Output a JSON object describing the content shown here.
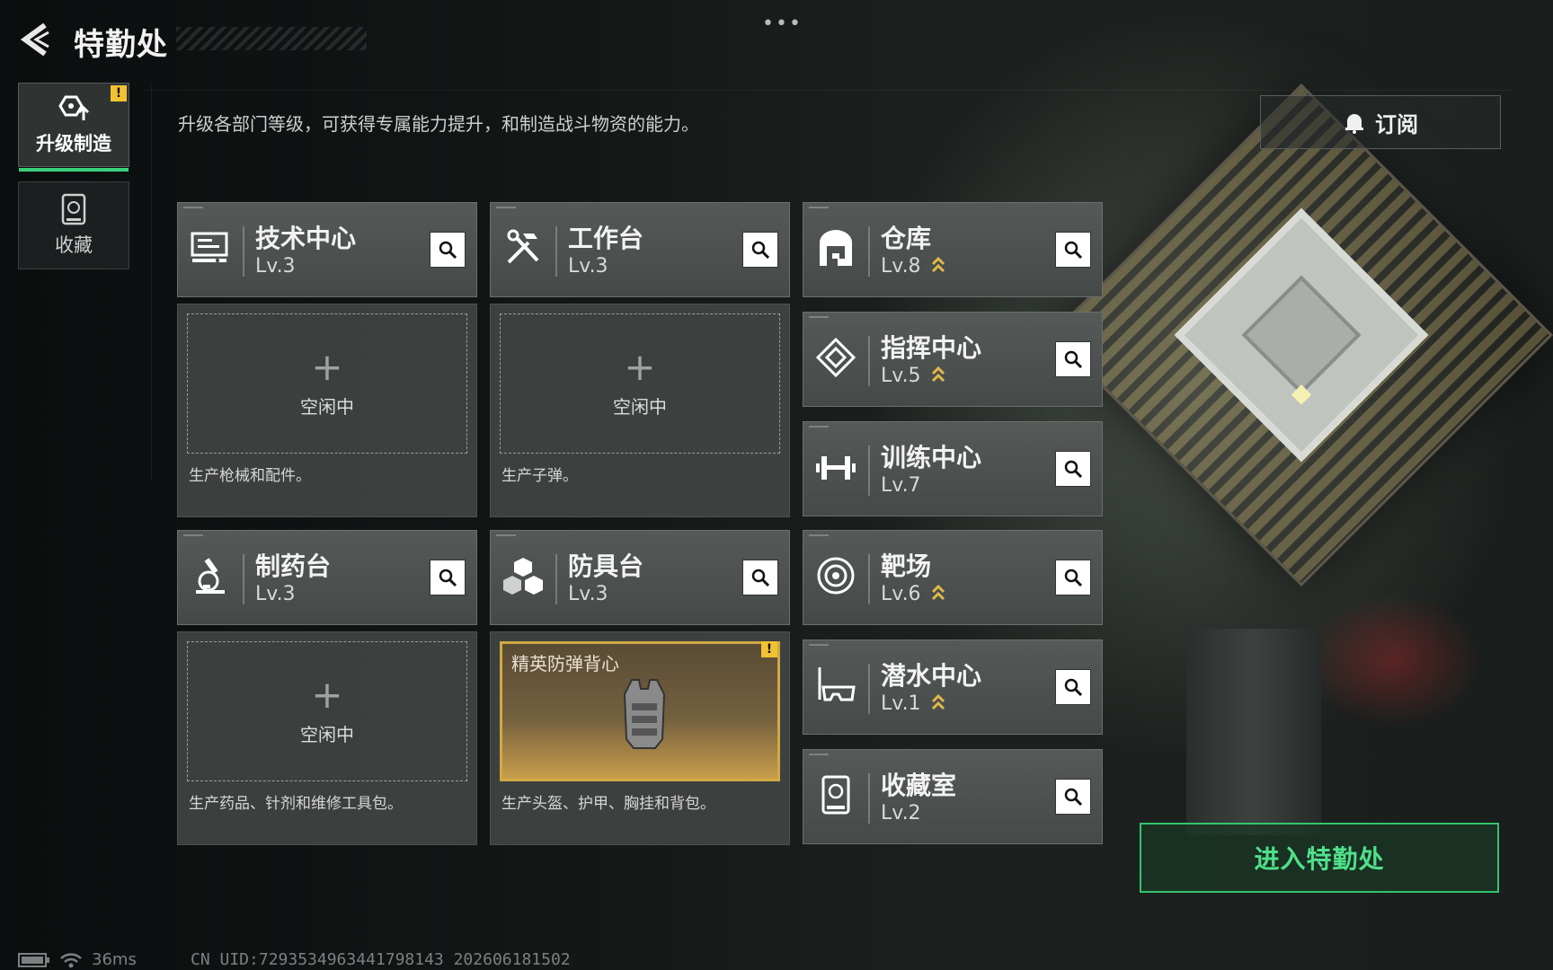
{
  "header": {
    "title": "特勤处"
  },
  "sidebar": {
    "tabs": [
      {
        "label": "升级制造",
        "active": true,
        "alert": "!"
      },
      {
        "label": "收藏",
        "active": false
      }
    ]
  },
  "main": {
    "description": "升级各部门等级，可获得专属能力提升，和制造战斗物资的能力。",
    "subscribe_label": "订阅",
    "enter_label": "进入特勤处"
  },
  "workshops": [
    {
      "name": "技术中心",
      "level": "Lv.3",
      "icon": "monitor-icon",
      "slot_plus": "+",
      "slot_text": "空闲中",
      "desc": "生产枪械和配件。"
    },
    {
      "name": "工作台",
      "level": "Lv.3",
      "icon": "tools-icon",
      "slot_plus": "+",
      "slot_text": "空闲中",
      "desc": "生产子弹。"
    },
    {
      "name": "制药台",
      "level": "Lv.3",
      "icon": "microscope-icon",
      "slot_plus": "+",
      "slot_text": "空闲中",
      "desc": "生产药品、针剂和维修工具包。"
    },
    {
      "name": "防具台",
      "level": "Lv.3",
      "icon": "cubes-icon",
      "crafting_item": "精英防弹背心",
      "alert": "!",
      "desc": "生产头盔、护甲、胸挂和背包。"
    }
  ],
  "facilities": [
    {
      "name": "仓库",
      "level": "Lv.8",
      "upgradable": true,
      "icon": "warehouse-icon"
    },
    {
      "name": "指挥中心",
      "level": "Lv.5",
      "upgradable": true,
      "icon": "command-icon"
    },
    {
      "name": "训练中心",
      "level": "Lv.7",
      "upgradable": false,
      "icon": "dumbbell-icon"
    },
    {
      "name": "靶场",
      "level": "Lv.6",
      "upgradable": true,
      "icon": "target-icon"
    },
    {
      "name": "潜水中心",
      "level": "Lv.1",
      "upgradable": true,
      "icon": "diving-mask-icon"
    },
    {
      "name": "收藏室",
      "level": "Lv.2",
      "upgradable": false,
      "icon": "collection-icon"
    }
  ],
  "status": {
    "ping": "36ms",
    "uid": "CN UID:7293534963441798143 202606181502"
  },
  "colors": {
    "accent": "#3ad17a",
    "warning": "#f1c232",
    "upgrade": "#e0b84a",
    "enter_text": "#4fe08a"
  }
}
